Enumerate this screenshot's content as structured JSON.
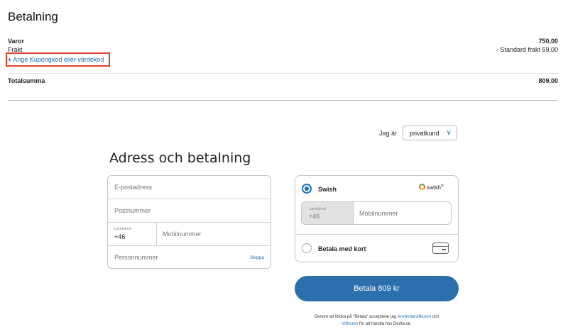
{
  "title": "Betalning",
  "summary": {
    "goods_label": "Varor",
    "goods_value": "750,00",
    "shipping_label": "Frakt",
    "shipping_value": "- Standard frakt 59,00",
    "coupon_icon": "plus-icon",
    "coupon_plus": "+",
    "coupon_label": "Ange Kupongkod eller värdekod",
    "total_label": "Totalsumma",
    "total_value": "809,00"
  },
  "customer_type": {
    "label": "Jag är",
    "selected": "privatkund",
    "chevron": "∨"
  },
  "address": {
    "heading": "Adress och betalning",
    "email_placeholder": "E-postadress",
    "postal_placeholder": "Postnummer",
    "country_code_label": "Landskod",
    "country_code_value": "+46",
    "mobile_placeholder": "Mobilnummer",
    "personal_number_placeholder": "Personnummer",
    "skip_label": "Skippa"
  },
  "payment": {
    "swish_label": "Swish",
    "swish_logo_text": "swish",
    "swish_logo_mark": "®",
    "country_code_label": "Landskod",
    "country_code_value": "+46",
    "mobile_placeholder": "Mobilnummer",
    "card_label": "Betala med kort",
    "card_icon": "credit-card-icon",
    "pay_button": "Betala 809 kr"
  },
  "terms": {
    "part1": "Genom att klicka på \"Betala\" accepterar jag ",
    "link1": "Användarvillkoren",
    "part2": " och",
    "link2": "Villkoren",
    "part3": " för att handla hos Dorita.se."
  },
  "colors": {
    "accent": "#2b6fad",
    "link": "#1f6fb5",
    "highlight_box": "#e0402a"
  }
}
